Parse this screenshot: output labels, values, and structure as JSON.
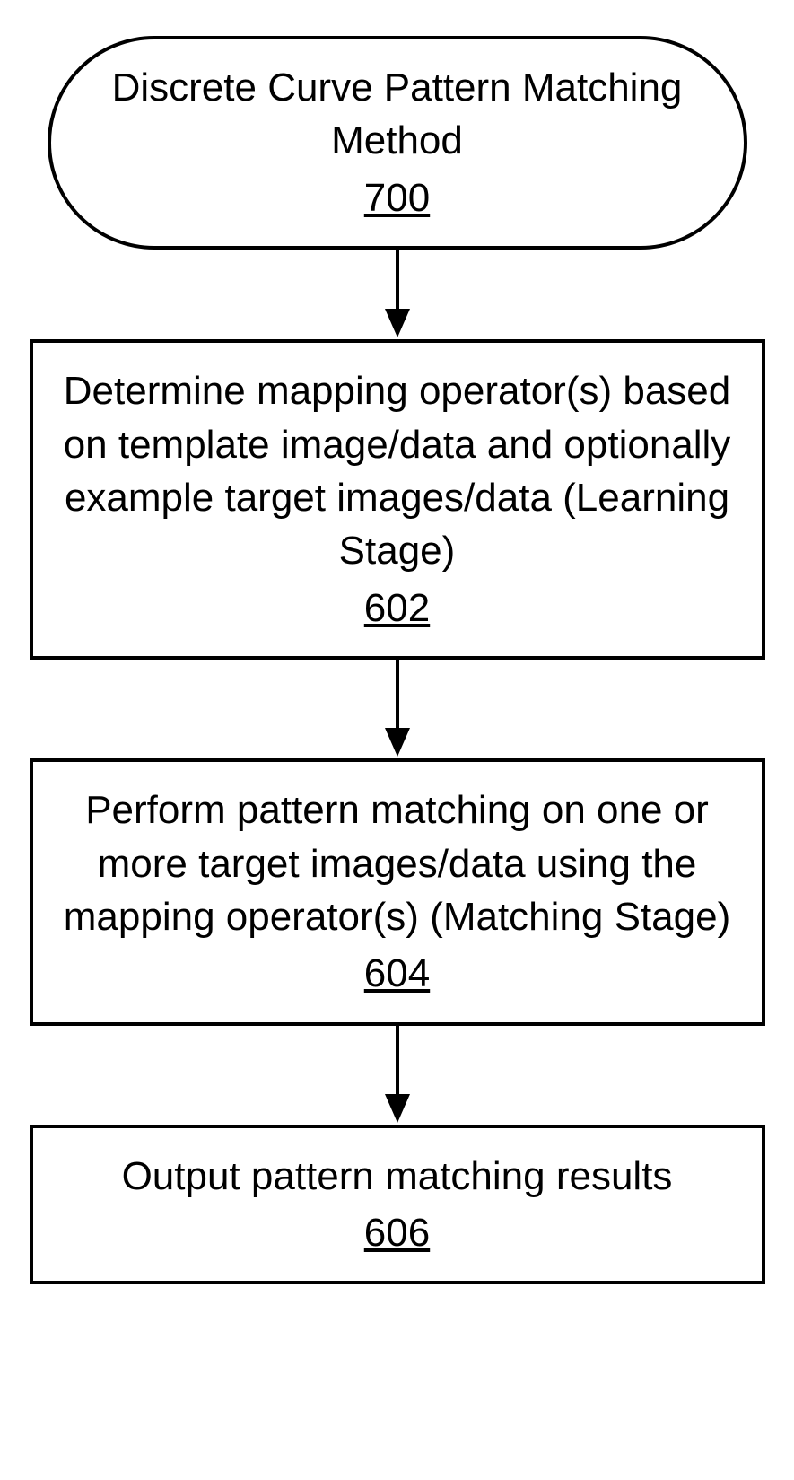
{
  "chart_data": {
    "type": "flowchart",
    "nodes": [
      {
        "id": "700",
        "shape": "terminator",
        "text": "Discrete Curve Pattern Matching Method",
        "ref": "700"
      },
      {
        "id": "602",
        "shape": "process",
        "text": "Determine mapping operator(s) based on template image/data and optionally example target images/data (Learning Stage)",
        "ref": "602"
      },
      {
        "id": "604",
        "shape": "process",
        "text": "Perform pattern matching on one or more target images/data using the mapping operator(s) (Matching Stage)",
        "ref": "604"
      },
      {
        "id": "606",
        "shape": "process",
        "text": "Output pattern matching results",
        "ref": "606"
      }
    ],
    "edges": [
      {
        "from": "700",
        "to": "602"
      },
      {
        "from": "602",
        "to": "604"
      },
      {
        "from": "604",
        "to": "606"
      }
    ]
  },
  "nodes": {
    "n0": {
      "text": "Discrete Curve Pattern Matching Method",
      "ref": "700"
    },
    "n1": {
      "text": "Determine mapping operator(s) based on template image/data and optionally example target images/data (Learning Stage)",
      "ref": "602"
    },
    "n2": {
      "text": "Perform pattern matching on one or more target images/data using the mapping operator(s) (Matching Stage)",
      "ref": "604"
    },
    "n3": {
      "text": "Output pattern matching results",
      "ref": "606"
    }
  }
}
